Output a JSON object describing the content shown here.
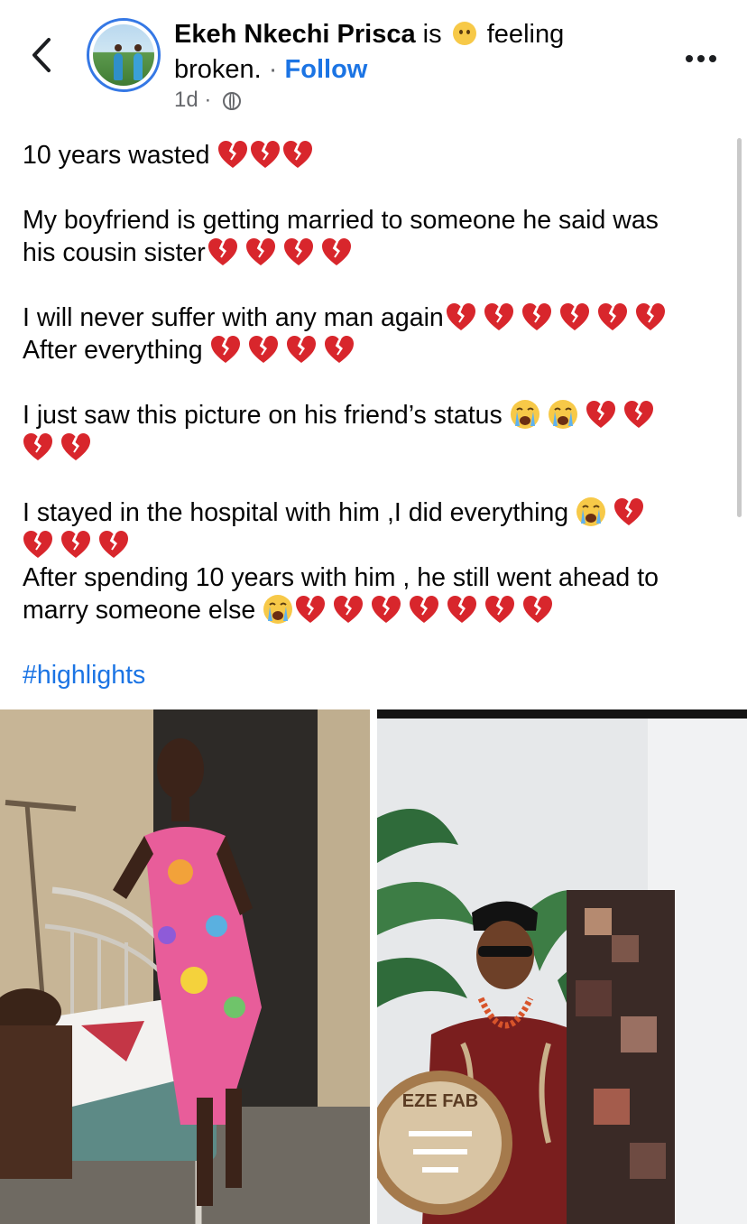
{
  "header": {
    "author": "Ekeh Nkechi Prisca",
    "verb": "is",
    "feeling": "feeling",
    "feeling_value": "broken.",
    "separator": "·",
    "follow_label": "Follow",
    "time": "1d",
    "time_separator": "·",
    "audience_icon": "globe-icon",
    "back_icon": "chevron-left-icon",
    "more_icon": "more-horizontal-icon"
  },
  "post": {
    "line1": "10 years wasted",
    "line2a": "My boyfriend is getting married to someone he said was",
    "line2b": "his cousin sister",
    "line3a": "I will never suffer with any man again",
    "line3b": "After everything",
    "line4": "I just saw this picture on  his friend’s status",
    "line5a": "I stayed in the hospital with him ,I did everything",
    "line5b": "After spending  10 years with him , he still went ahead to",
    "line5c": "marry someone else",
    "hashtag": "#highlights"
  },
  "photos": {
    "left_desc_icon": "photo-hospital",
    "right_logo_text": "EZE FAB"
  },
  "colors": {
    "link": "#1b74e4",
    "text": "#050505",
    "meta": "#65676b",
    "heart": "#d8262c"
  }
}
